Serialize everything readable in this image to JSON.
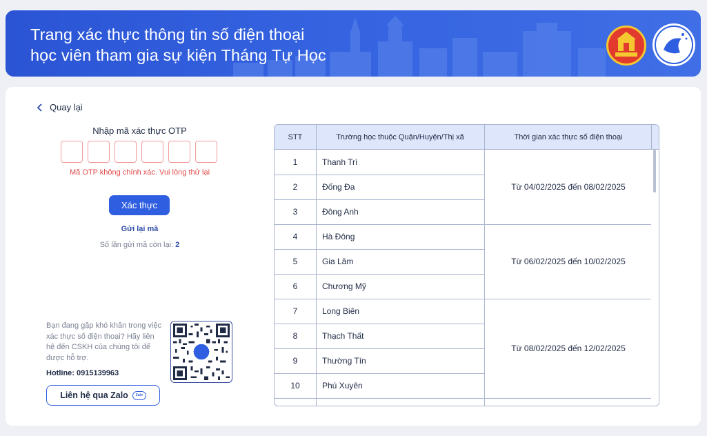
{
  "header": {
    "title_line1": "Trang xác thực thông tin số điện thoại",
    "title_line2": "học viên tham gia sự kiện Tháng Tự Học",
    "logos": [
      "hanoi-library-logo-icon",
      "event-logo-icon"
    ]
  },
  "back_link": "Quay lại",
  "otp": {
    "title": "Nhập mã xác thực OTP",
    "digits": [
      "",
      "",
      "",
      "",
      "",
      ""
    ],
    "error": "Mã OTP không chính xác. Vui lòng thử lại",
    "verify_label": "Xác thực",
    "resend_label": "Gửi lại mã",
    "remaining_label": "Số lần gửi mã còn lại:",
    "remaining_count": "2"
  },
  "support": {
    "help_text": "Bạn đang gặp khó khăn trong việc xác thực số điện thoại? Hãy liên hệ đến CSKH của chúng tôi để được hỗ trợ.",
    "hotline": "Hotline: 0915139963",
    "zalo_label": "Liên hệ qua Zalo",
    "zalo_icon_text": "Zalo"
  },
  "table": {
    "headers": [
      "STT",
      "Trường học thuộc Quận/Huyện/Thị xã",
      "Thời gian xác thực số điện thoại"
    ],
    "rows": [
      {
        "stt": "1",
        "school": "Thanh Trì"
      },
      {
        "stt": "2",
        "school": "Đống Đa"
      },
      {
        "stt": "3",
        "school": "Đông Anh"
      },
      {
        "stt": "4",
        "school": "Hà Đông"
      },
      {
        "stt": "5",
        "school": "Gia Lâm"
      },
      {
        "stt": "6",
        "school": "Chương Mỹ"
      },
      {
        "stt": "7",
        "school": "Long Biên"
      },
      {
        "stt": "8",
        "school": "Thạch Thất"
      },
      {
        "stt": "9",
        "school": "Thường Tín"
      },
      {
        "stt": "10",
        "school": "Phú Xuyên"
      }
    ],
    "periods": [
      {
        "label": "Từ 04/02/2025 đến 08/02/2025",
        "rows": 3
      },
      {
        "label": "Từ 06/02/2025 đến 10/02/2025",
        "rows": 3
      },
      {
        "label": "Từ 08/02/2025 đến 12/02/2025",
        "rows": 4
      }
    ]
  },
  "colors": {
    "primary": "#2f5fe0",
    "banner": "#3563e0",
    "error": "#e24a4a",
    "table_header_bg": "#dde6fb"
  }
}
